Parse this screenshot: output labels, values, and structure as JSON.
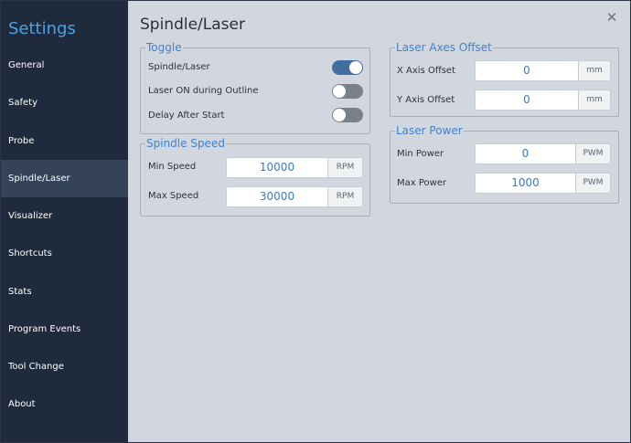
{
  "sidebar": {
    "title": "Settings",
    "items": [
      {
        "label": "General",
        "active": false
      },
      {
        "label": "Safety",
        "active": false
      },
      {
        "label": "Probe",
        "active": false
      },
      {
        "label": "Spindle/Laser",
        "active": true
      },
      {
        "label": "Visualizer",
        "active": false
      },
      {
        "label": "Shortcuts",
        "active": false
      },
      {
        "label": "Stats",
        "active": false
      },
      {
        "label": "Program Events",
        "active": false
      },
      {
        "label": "Tool Change",
        "active": false
      },
      {
        "label": "About",
        "active": false
      }
    ]
  },
  "page": {
    "title": "Spindle/Laser",
    "close_icon": "close-icon"
  },
  "toggle_section": {
    "legend": "Toggle",
    "items": [
      {
        "label": "Spindle/Laser",
        "on": true
      },
      {
        "label": "Laser ON during Outline",
        "on": false
      },
      {
        "label": "Delay After Start",
        "on": false
      }
    ]
  },
  "spindle_speed": {
    "legend": "Spindle Speed",
    "min": {
      "label": "Min Speed",
      "value": "10000",
      "unit": "RPM"
    },
    "max": {
      "label": "Max Speed",
      "value": "30000",
      "unit": "RPM"
    }
  },
  "laser_axes_offset": {
    "legend": "Laser Axes Offset",
    "x": {
      "label": "X Axis Offset",
      "value": "0",
      "unit": "mm"
    },
    "y": {
      "label": "Y Axis Offset",
      "value": "0",
      "unit": "mm"
    }
  },
  "laser_power": {
    "legend": "Laser Power",
    "min": {
      "label": "Min Power",
      "value": "0",
      "unit": "PWM"
    },
    "max": {
      "label": "Max Power",
      "value": "1000",
      "unit": "PWM"
    }
  },
  "colors": {
    "accent": "#4aa3e8",
    "sidebar_bg": "#1f2b3d",
    "sidebar_active": "#35435a",
    "panel_bg": "#d2d6de",
    "toggle_on": "#3f6ea1",
    "toggle_off": "#7a8089"
  }
}
